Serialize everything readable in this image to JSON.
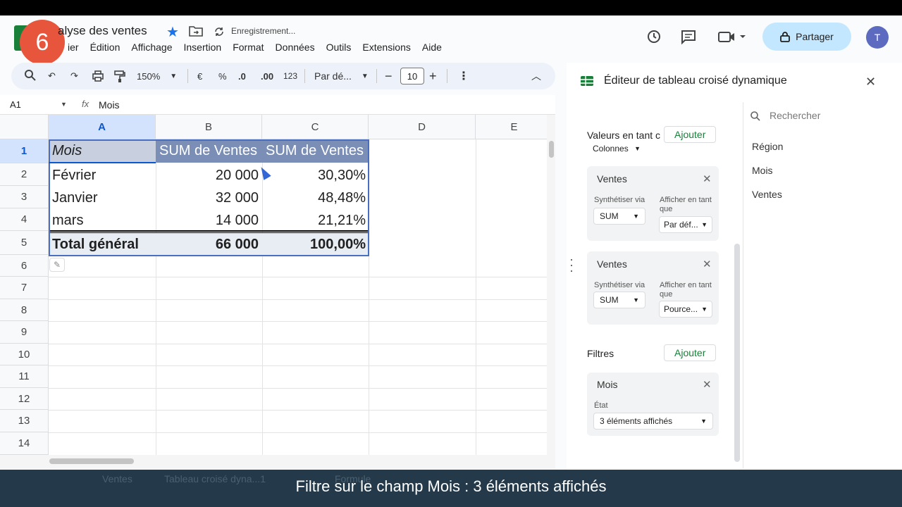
{
  "step_badge": "6",
  "doc": {
    "title_visible": "alyse des ventes",
    "saving_status": "Enregistrement..."
  },
  "menu": [
    "ier",
    "Édition",
    "Affichage",
    "Insertion",
    "Format",
    "Données",
    "Outils",
    "Extensions",
    "Aide"
  ],
  "header": {
    "share_label": "Partager",
    "avatar_initial": "T"
  },
  "toolbar": {
    "zoom": "150%",
    "currency": "€",
    "percent": "%",
    "dec_less": ".0",
    "dec_more": ".00",
    "number_format": "123",
    "font": "Par dé...",
    "font_size": "10"
  },
  "formula_bar": {
    "cell_ref": "A1",
    "fx": "fx",
    "value": "Mois"
  },
  "columns": [
    "A",
    "B",
    "C",
    "D",
    "E"
  ],
  "rows": [
    "1",
    "2",
    "3",
    "4",
    "5",
    "6",
    "7",
    "8",
    "9",
    "10",
    "11",
    "12",
    "13",
    "14"
  ],
  "table": {
    "header": [
      "Mois",
      "SUM de Ventes",
      "SUM de Ventes"
    ],
    "body": [
      [
        "Février",
        "20 000",
        "30,30%"
      ],
      [
        "Janvier",
        "32 000",
        "48,48%"
      ],
      [
        "mars",
        "14 000",
        "21,21%"
      ]
    ],
    "total": [
      "Total général",
      "66 000",
      "100,00%"
    ]
  },
  "pivot_editor": {
    "title": "Éditeur de tableau croisé dynamique",
    "values_label": "Valeurs en tant c",
    "add_label": "Ajouter",
    "values_position": "Colonnes",
    "search_placeholder": "Rechercher",
    "fields": [
      "Région",
      "Mois",
      "Ventes"
    ],
    "value_cards": [
      {
        "title": "Ventes",
        "summarize_label": "Synthétiser via",
        "summarize_value": "SUM",
        "show_as_label": "Afficher en tant que",
        "show_as_value": "Par déf..."
      },
      {
        "title": "Ventes",
        "summarize_label": "Synthétiser via",
        "summarize_value": "SUM",
        "show_as_label": "Afficher en tant que",
        "show_as_value": "Pource..."
      }
    ],
    "filters_label": "Filtres",
    "filter_card": {
      "title": "Mois",
      "status_label": "État",
      "status_value": "3 éléments affichés"
    }
  },
  "sheet_tabs": [
    "Ventes",
    "Tableau croisé dyna...1",
    "Formule"
  ],
  "caption": "Filtre sur le champ Mois : 3 éléments affichés"
}
